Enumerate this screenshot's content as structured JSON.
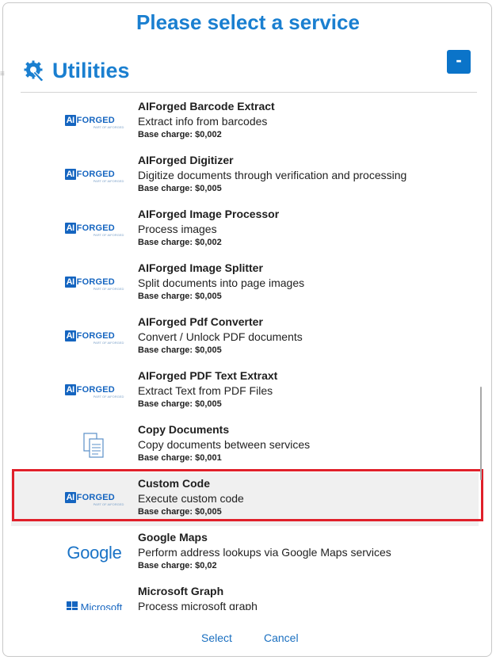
{
  "dialog": {
    "title": "Please select a service",
    "section_title": "Utilities",
    "collapse_label": "-"
  },
  "services": [
    {
      "name": "AIForged Barcode Extract",
      "description": "Extract info from barcodes",
      "charge": "Base charge: $0,002",
      "logo": "aiforged-logo"
    },
    {
      "name": "AIForged Digitizer",
      "description": "Digitize documents through verification and processing",
      "charge": "Base charge: $0,005",
      "logo": "aiforged-logo"
    },
    {
      "name": "AIForged Image Processor",
      "description": "Process images",
      "charge": "Base charge: $0,002",
      "logo": "aiforged-logo"
    },
    {
      "name": "AIForged Image Splitter",
      "description": "Split documents into page images",
      "charge": "Base charge: $0,005",
      "logo": "aiforged-logo"
    },
    {
      "name": "AIForged Pdf Converter",
      "description": "Convert / Unlock PDF documents",
      "charge": "Base charge: $0,005",
      "logo": "aiforged-logo"
    },
    {
      "name": "AIForged PDF Text Extraxt",
      "description": "Extract Text from PDF Files",
      "charge": "Base charge: $0,005",
      "logo": "aiforged-logo"
    },
    {
      "name": "Copy Documents",
      "description": "Copy documents between services",
      "charge": "Base charge: $0,001",
      "logo": "copy-documents-icon"
    },
    {
      "name": "Custom Code",
      "description": "Execute custom code",
      "charge": "Base charge: $0,005",
      "logo": "aiforged-logo",
      "selected": true
    },
    {
      "name": "Google Maps",
      "description": "Perform address lookups via Google Maps services",
      "charge": "Base charge: $0,02",
      "logo": "google-logo"
    },
    {
      "name": "Microsoft Graph",
      "description": "Process microsoft graph",
      "charge": "",
      "logo": "microsoft-logo"
    }
  ],
  "logos": {
    "aiforged_badge": "AI",
    "aiforged_text": "FORGED",
    "aiforged_sub": "PART OF AIFORGED",
    "google_text": "Google",
    "microsoft_text": "Microsoft"
  },
  "footer": {
    "select_label": "Select",
    "cancel_label": "Cancel"
  },
  "colors": {
    "accent": "#1a7fd0",
    "button": "#0b74c9",
    "highlight": "#e0202a"
  }
}
